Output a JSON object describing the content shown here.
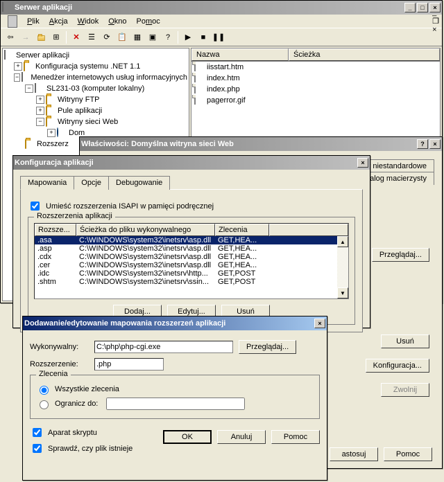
{
  "mainWindow": {
    "title": "Serwer aplikacji",
    "menu": [
      "Plik",
      "Akcja",
      "Widok",
      "Okno",
      "Pomoc"
    ]
  },
  "tree": {
    "root": "Serwer aplikacji",
    "n1": "Konfiguracja systemu .NET 1.1",
    "n2": "Menedżer internetowych usług informacyjnych",
    "n3": "SL231-03 (komputer lokalny)",
    "n4": "Witryny FTP",
    "n5": "Pule aplikacji",
    "n6": "Witryny sieci Web",
    "n7": "Dom",
    "n8": "Rozszerz"
  },
  "list": {
    "colName": "Nazwa",
    "colPath": "Ścieżka",
    "items": [
      "iisstart.htm",
      "index.htm",
      "index.php",
      "pagerror.gif"
    ]
  },
  "propsDialog": {
    "title": "Właściwości: Domyślna witryna sieci Web",
    "tabErrors": "Błędy niestandardowe",
    "tabHome": "Katalog macierzysty",
    "btnBrowse": "Przeglądaj...",
    "btnRemove": "Usuń",
    "btnConfig": "Konfiguracja...",
    "btnRelease": "Zwolnij",
    "btnApply": "astosuj",
    "btnHelp": "Pomoc"
  },
  "configDialog": {
    "title": "Konfiguracja aplikacji",
    "tabMap": "Mapowania",
    "tabOpt": "Opcje",
    "tabDbg": "Debugowanie",
    "chkCache": "Umieść rozszerzenia ISAPI w pamięci podręcznej",
    "gboxExt": "Rozszerzenia aplikacji",
    "colExt": "Rozsze...",
    "colPath": "Ścieżka do pliku wykonywalnego",
    "colVerbs": "Zlecenia",
    "rows": [
      {
        "ext": ".asa",
        "path": "C:\\WINDOWS\\system32\\inetsrv\\asp.dll",
        "verbs": "GET,HEA..."
      },
      {
        "ext": ".asp",
        "path": "C:\\WINDOWS\\system32\\inetsrv\\asp.dll",
        "verbs": "GET,HEA..."
      },
      {
        "ext": ".cdx",
        "path": "C:\\WINDOWS\\system32\\inetsrv\\asp.dll",
        "verbs": "GET,HEA..."
      },
      {
        "ext": ".cer",
        "path": "C:\\WINDOWS\\system32\\inetsrv\\asp.dll",
        "verbs": "GET,HEA..."
      },
      {
        "ext": ".idc",
        "path": "C:\\WINDOWS\\system32\\inetsrv\\http...",
        "verbs": "GET,POST"
      },
      {
        "ext": ".shtm",
        "path": "C:\\WINDOWS\\system32\\inetsrv\\ssin...",
        "verbs": "GET,POST"
      }
    ],
    "btnAdd": "Dodaj...",
    "btnEdit": "Edytuj...",
    "btnDel": "Usuń"
  },
  "addDialog": {
    "title": "Dodawanie/edytowanie mapowania rozszerzeń aplikacji",
    "lblExec": "Wykonywalny:",
    "valExec": "C:\\php\\php-cgi.exe",
    "btnBrowse": "Przeglądaj...",
    "lblExt": "Rozszerzenie:",
    "valExt": ".php",
    "gboxVerbs": "Zlecenia",
    "radioAll": "Wszystkie zlecenia",
    "radioLimit": "Ogranicz do:",
    "chkEngine": "Aparat skryptu",
    "chkFileExists": "Sprawdź, czy plik istnieje",
    "btnOK": "OK",
    "btnCancel": "Anuluj",
    "btnHelp": "Pomoc"
  }
}
